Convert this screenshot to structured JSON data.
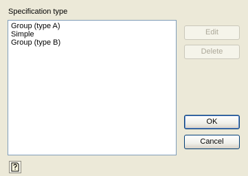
{
  "group_label": "Specification type",
  "list": {
    "items": [
      "Group (type A)",
      "Simple",
      "Group (type B)"
    ]
  },
  "buttons": {
    "edit": "Edit",
    "delete": "Delete",
    "ok": "OK",
    "cancel": "Cancel"
  },
  "icons": {
    "help": "help-icon"
  }
}
